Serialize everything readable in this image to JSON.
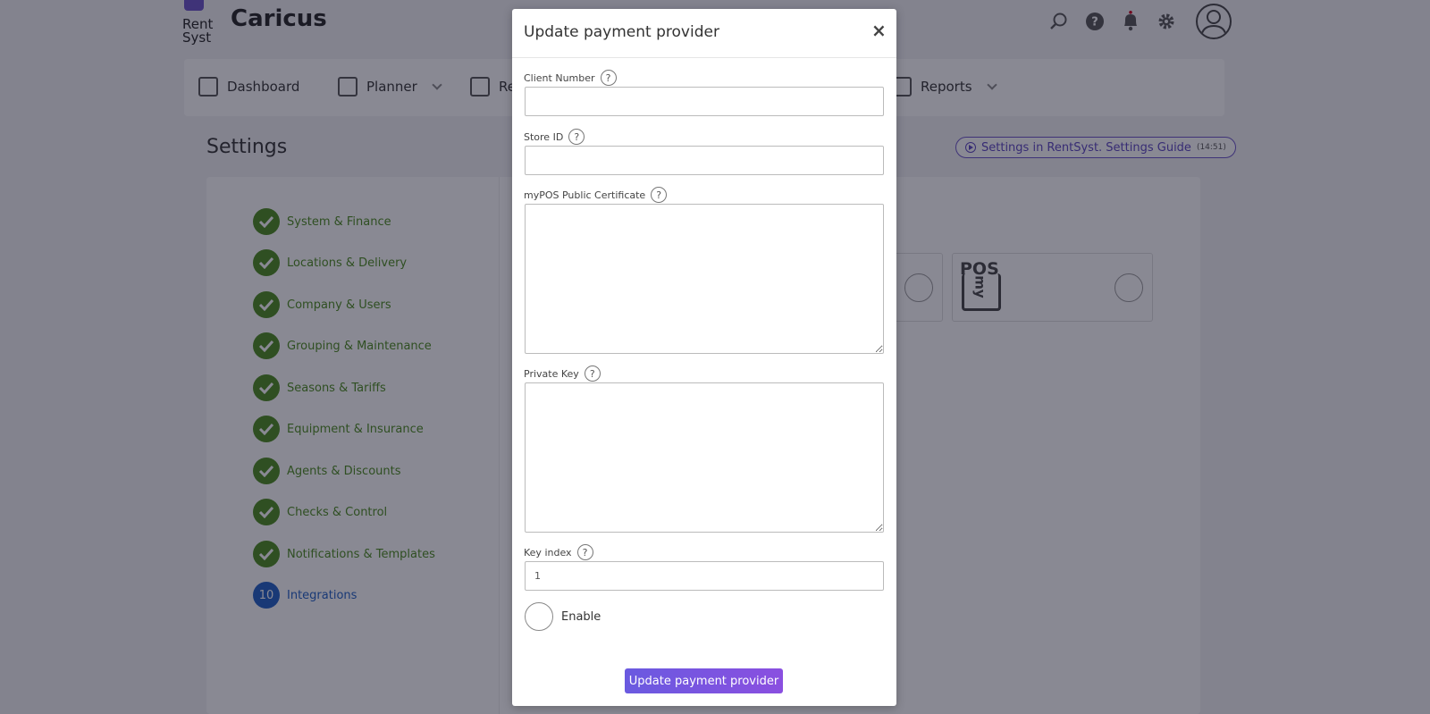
{
  "app": {
    "logo_line1": "Rent",
    "logo_line2": "Syst",
    "company_name": "Caricus",
    "top_icons": [
      "search-icon",
      "help-icon",
      "bell-icon",
      "gear-icon",
      "user-avatar-icon"
    ]
  },
  "nav": {
    "items": [
      {
        "label": "Dashboard",
        "icon": "dashboard-icon"
      },
      {
        "label": "Planner",
        "icon": "calendar-icon"
      },
      {
        "label": "Re",
        "icon": "reservations-icon"
      },
      {
        "label": "Reports",
        "icon": "reports-icon"
      }
    ]
  },
  "settings": {
    "title": "Settings",
    "guide_label": "Settings in RentSyst. Settings Guide",
    "guide_duration": "(14:51)",
    "steps": [
      {
        "label": "System & Finance",
        "done": true
      },
      {
        "label": "Locations & Delivery",
        "done": true
      },
      {
        "label": "Company & Users",
        "done": true
      },
      {
        "label": "Grouping & Maintenance",
        "done": true
      },
      {
        "label": "Seasons & Tariffs",
        "done": true
      },
      {
        "label": "Equipment & Insurance",
        "done": true
      },
      {
        "label": "Agents & Discounts",
        "done": true
      },
      {
        "label": "Checks & Control",
        "done": true
      },
      {
        "label": "Notifications & Templates",
        "done": true
      },
      {
        "label": "Integrations",
        "done": false,
        "number": "10"
      }
    ],
    "provider_logo": "POS",
    "provider_logo_sub": "my"
  },
  "modal": {
    "title": "Update payment provider",
    "close": "×",
    "fields": {
      "client_number": {
        "label": "Client Number",
        "value": ""
      },
      "store_id": {
        "label": "Store ID",
        "value": ""
      },
      "public_certificate": {
        "label": "myPOS Public Certificate",
        "value": ""
      },
      "private_key": {
        "label": "Private Key",
        "value": ""
      },
      "key_index": {
        "label": "Key index",
        "value": "1"
      }
    },
    "help_glyph": "?",
    "enable_label": "Enable",
    "submit_label": "Update payment provider"
  },
  "colors": {
    "accent": "#6a52c8",
    "success": "#4a8a1c",
    "active_step": "#1f5fc4"
  }
}
